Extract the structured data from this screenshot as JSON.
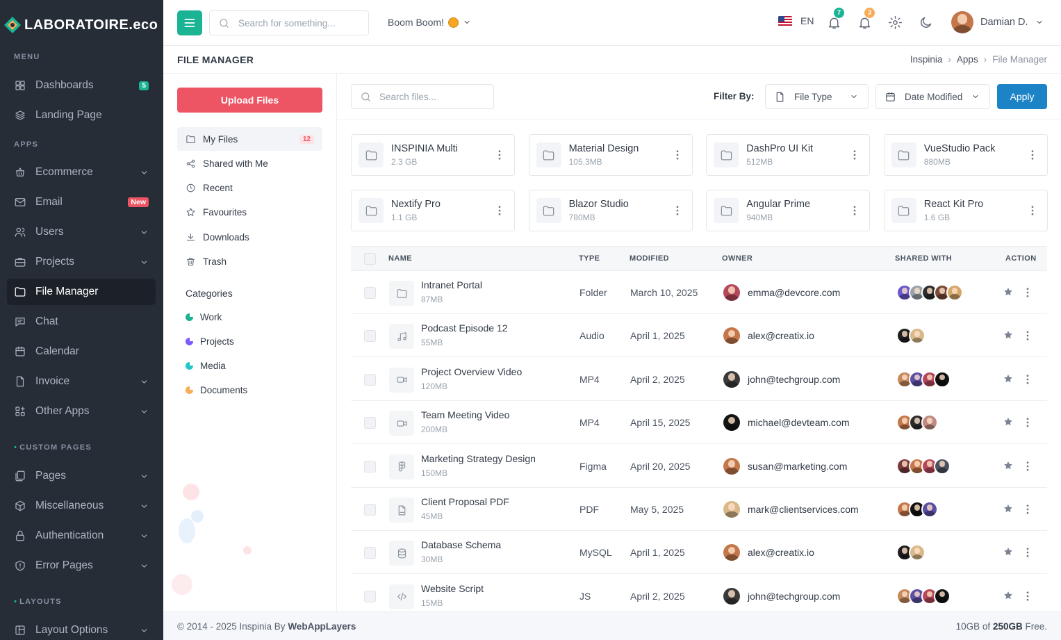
{
  "brand": {
    "name": "LABORATOIRE.eco"
  },
  "sidebar": {
    "sections": {
      "menu": "MENU",
      "apps": "APPS",
      "custom_pages": "CUSTOM PAGES",
      "layouts": "LAYOUTS"
    },
    "items": [
      {
        "label": "Dashboards",
        "icon": "dashboard-icon",
        "badge": "5"
      },
      {
        "label": "Landing Page",
        "icon": "stack-icon"
      },
      {
        "label": "Ecommerce",
        "icon": "basket-icon"
      },
      {
        "label": "Email",
        "icon": "mail-icon",
        "badge": "New"
      },
      {
        "label": "Users",
        "icon": "users-icon"
      },
      {
        "label": "Projects",
        "icon": "briefcase-icon"
      },
      {
        "label": "File Manager",
        "icon": "folder-icon"
      },
      {
        "label": "Chat",
        "icon": "chat-icon"
      },
      {
        "label": "Calendar",
        "icon": "calendar-icon"
      },
      {
        "label": "Invoice",
        "icon": "file-icon"
      },
      {
        "label": "Other Apps",
        "icon": "apps-icon"
      },
      {
        "label": "Pages",
        "icon": "pages-icon"
      },
      {
        "label": "Miscellaneous",
        "icon": "box-icon"
      },
      {
        "label": "Authentication",
        "icon": "lock-icon"
      },
      {
        "label": "Error Pages",
        "icon": "alert-icon"
      },
      {
        "label": "Layout Options",
        "icon": "layout-icon"
      }
    ]
  },
  "topbar": {
    "search_placeholder": "Search for something...",
    "workspace": "Boom Boom!",
    "language": "EN",
    "notifications_a": "7",
    "notifications_b": "3",
    "user_name": "Damian D."
  },
  "page": {
    "title": "FILE MANAGER",
    "breadcrumb": [
      "Inspinia",
      "Apps",
      "File Manager"
    ]
  },
  "file_nav": {
    "upload_label": "Upload Files",
    "items": [
      {
        "label": "My Files",
        "count": "12",
        "icon": "folder-icon"
      },
      {
        "label": "Shared with Me",
        "icon": "share-icon"
      },
      {
        "label": "Recent",
        "icon": "clock-icon"
      },
      {
        "label": "Favourites",
        "icon": "star-icon"
      },
      {
        "label": "Downloads",
        "icon": "download-icon"
      },
      {
        "label": "Trash",
        "icon": "trash-icon"
      }
    ],
    "categories_title": "Categories",
    "categories": [
      {
        "label": "Work",
        "color": "#1ab394"
      },
      {
        "label": "Projects",
        "color": "#7c5cff"
      },
      {
        "label": "Media",
        "color": "#23c6c8"
      },
      {
        "label": "Documents",
        "color": "#f8ac59"
      }
    ]
  },
  "toolbar": {
    "search_placeholder": "Search files...",
    "filter_label": "Filter By:",
    "file_type": "File Type",
    "date_modified": "Date Modified",
    "apply_label": "Apply"
  },
  "folders": [
    {
      "name": "INSPINIA Multi",
      "size": "2.3 GB"
    },
    {
      "name": "Material Design",
      "size": "105.3MB"
    },
    {
      "name": "DashPro UI Kit",
      "size": "512MB"
    },
    {
      "name": "VueStudio Pack",
      "size": "880MB"
    },
    {
      "name": "Nextify Pro",
      "size": "1.1 GB"
    },
    {
      "name": "Blazor Studio",
      "size": "780MB"
    },
    {
      "name": "Angular Prime",
      "size": "940MB"
    },
    {
      "name": "React Kit Pro",
      "size": "1.6 GB"
    }
  ],
  "table": {
    "headers": {
      "name": "NAME",
      "type": "TYPE",
      "modified": "MODIFIED",
      "owner": "OWNER",
      "shared": "SHARED WITH",
      "action": "ACTION"
    },
    "rows": [
      {
        "name": "Intranet Portal",
        "size": "87MB",
        "type": "Folder",
        "modified": "March 10, 2025",
        "owner": "emma@devcore.com",
        "icon": "folder-icon",
        "owner_color": "#b5495b",
        "shared": [
          "#6a5acd",
          "#9aa3ad",
          "#2d2d2d",
          "#7a4a3a",
          "#d4a76a"
        ]
      },
      {
        "name": "Podcast Episode 12",
        "size": "55MB",
        "type": "Audio",
        "modified": "April 1, 2025",
        "owner": "alex@creatix.io",
        "icon": "music-icon",
        "owner_color": "#c4774a",
        "shared": [
          "#1f1f1f",
          "#d9b98a"
        ]
      },
      {
        "name": "Project Overview Video",
        "size": "120MB",
        "type": "MP4",
        "modified": "April 2, 2025",
        "owner": "john@techgroup.com",
        "icon": "video-icon",
        "owner_color": "#3a3a3a",
        "shared": [
          "#c68a5e",
          "#5b4fa3",
          "#b5495b",
          "#111111"
        ]
      },
      {
        "name": "Team Meeting Video",
        "size": "200MB",
        "type": "MP4",
        "modified": "April 15, 2025",
        "owner": "michael@devteam.com",
        "icon": "video-icon",
        "owner_color": "#151515",
        "shared": [
          "#c4774a",
          "#2d2d2d",
          "#c08a80"
        ]
      },
      {
        "name": "Marketing Strategy Design",
        "size": "150MB",
        "type": "Figma",
        "modified": "April 20, 2025",
        "owner": "susan@marketing.com",
        "icon": "figma-icon",
        "owner_color": "#c4774a",
        "shared": [
          "#7a3a3a",
          "#c4774a",
          "#b5495b",
          "#4a5260"
        ]
      },
      {
        "name": "Client Proposal PDF",
        "size": "45MB",
        "type": "PDF",
        "modified": "May 5, 2025",
        "owner": "mark@clientservices.com",
        "icon": "pdf-icon",
        "owner_color": "#d9b98a",
        "shared": [
          "#c4774a",
          "#111111",
          "#5b4fa3"
        ]
      },
      {
        "name": "Database Schema",
        "size": "30MB",
        "type": "MySQL",
        "modified": "April 1, 2025",
        "owner": "alex@creatix.io",
        "icon": "database-icon",
        "owner_color": "#c4774a",
        "shared": [
          "#1f1f1f",
          "#d9b98a"
        ]
      },
      {
        "name": "Website Script",
        "size": "15MB",
        "type": "JS",
        "modified": "April 2, 2025",
        "owner": "john@techgroup.com",
        "icon": "code-icon",
        "owner_color": "#3a3a3a",
        "shared": [
          "#c68a5e",
          "#5b4fa3",
          "#b5495b",
          "#111111"
        ]
      }
    ]
  },
  "footer": {
    "copyright": "© 2014 - 2025 Inspinia By",
    "company": "WebAppLayers",
    "storage_used": "10GB of",
    "storage_total": "250GB",
    "storage_suffix": "Free."
  }
}
